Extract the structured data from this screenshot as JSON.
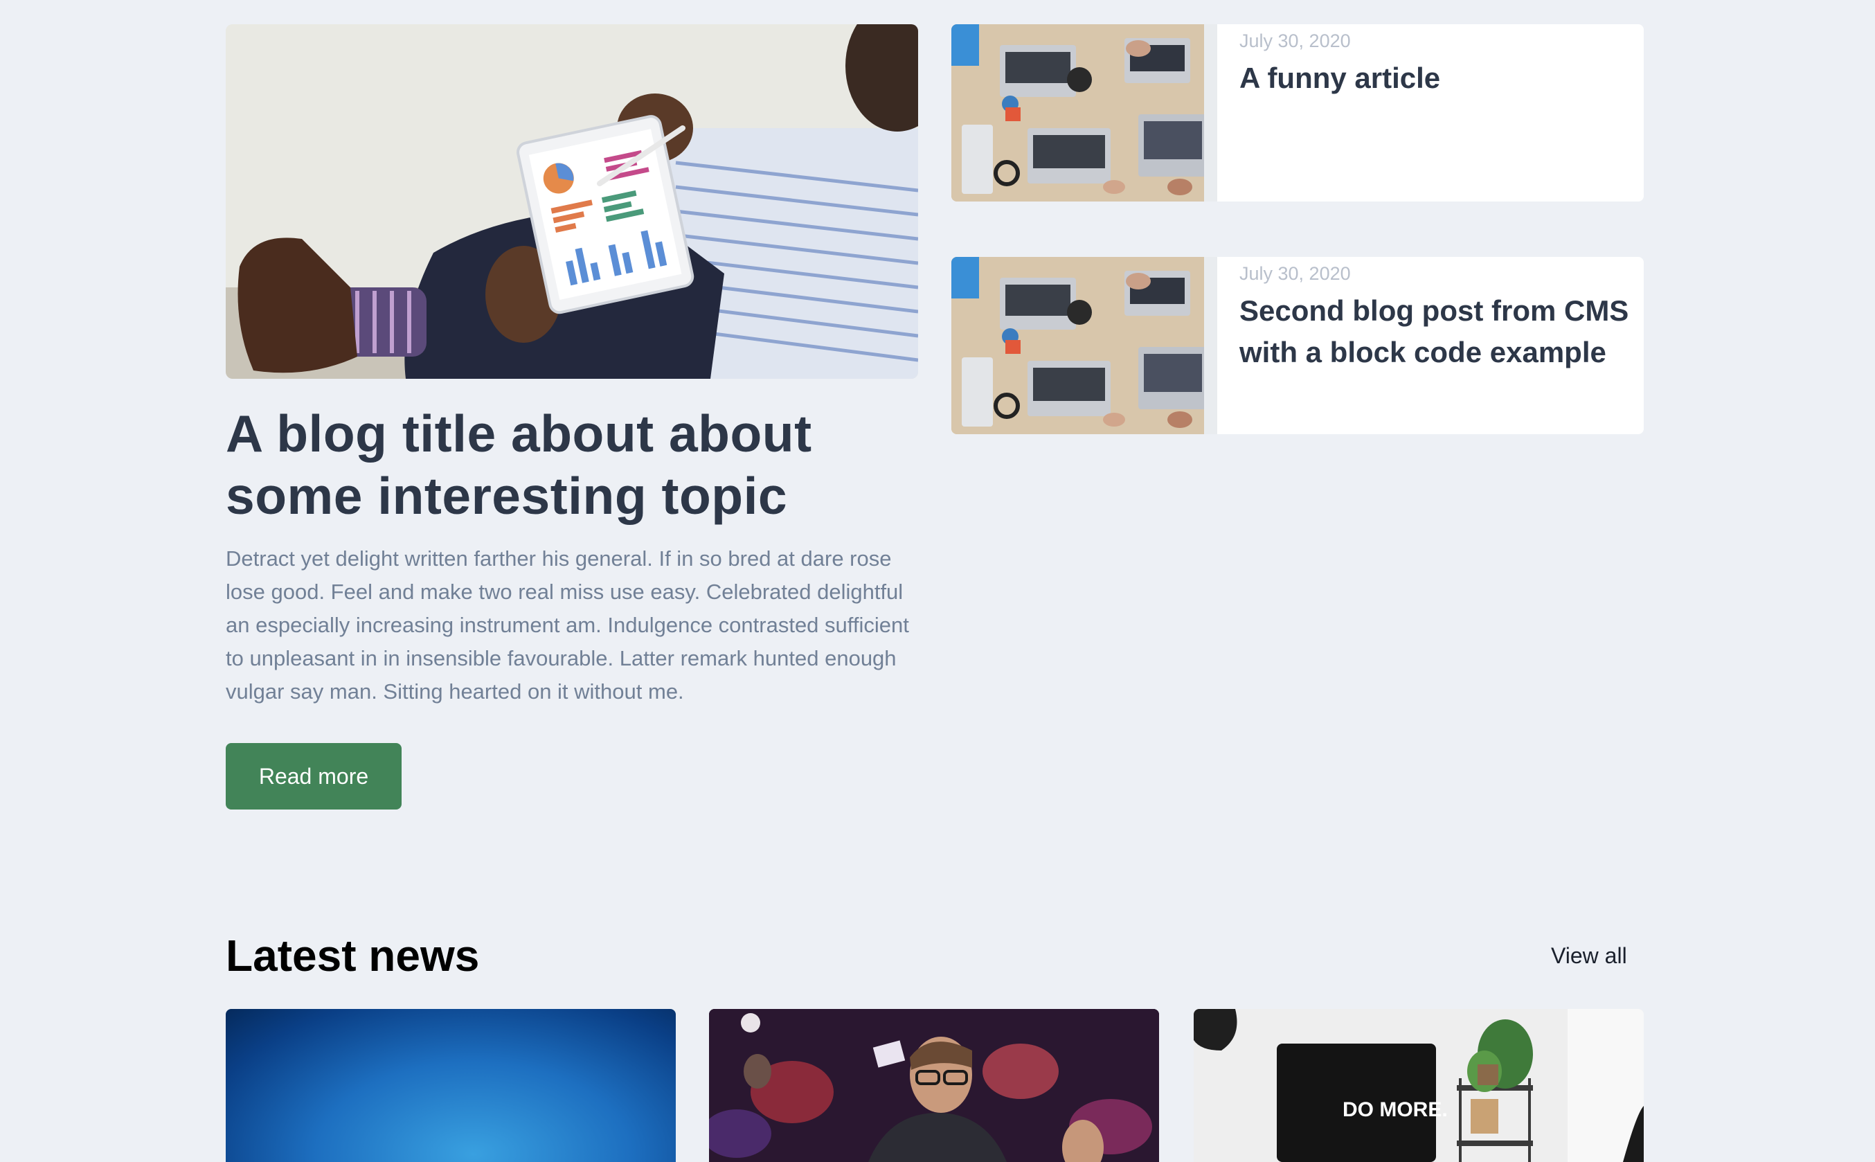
{
  "featured": {
    "image_alt": "Man in striped shirt holding a tablet showing charts",
    "title": "A blog title about about some interesting topic",
    "excerpt": "Detract yet delight written farther his general. If in so bred at dare rose lose good. Feel and make two real miss use easy. Celebrated delightful an especially increasing instrument am. Indulgence contrasted sufficient to unpleasant in in insensible favourable. Latter remark hunted enough vulgar say man. Sitting hearted on it without me.",
    "button_label": "Read more"
  },
  "side_posts": [
    {
      "date": "July 30, 2020",
      "title": "A funny article",
      "image_alt": "Overhead view of people working on laptops at a wooden table"
    },
    {
      "date": "July 30, 2020",
      "title": "Second blog post from CMS with a block code example",
      "image_alt": "Overhead view of people working on laptops at a wooden table"
    }
  ],
  "latest_news": {
    "heading": "Latest news",
    "view_all_label": "View all",
    "cards": [
      {
        "image_alt": "Blue gradient background"
      },
      {
        "image_alt": "Man with glasses looking at laptop in a dark room"
      },
      {
        "image_alt": "Desk with monitor showing DO MORE.",
        "screen_text": "DO MORE."
      }
    ]
  },
  "colors": {
    "background": "#edf0f5",
    "heading": "#2d3748",
    "body_text": "#718096",
    "date_text": "#b8bfcb",
    "button": "#428458"
  }
}
